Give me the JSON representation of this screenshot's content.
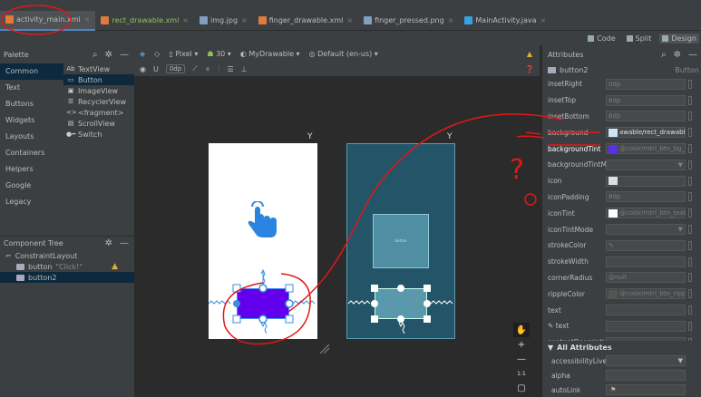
{
  "tabs": [
    {
      "label": "activity_main.xml",
      "color": "#e07b3a",
      "active": true
    },
    {
      "label": "rect_drawable.xml",
      "color": "#e07b3a",
      "green": true
    },
    {
      "label": "img.jpg",
      "color": "#7fa0c0"
    },
    {
      "label": "finger_drawable.xml",
      "color": "#e07b3a"
    },
    {
      "label": "finger_pressed.png",
      "color": "#7fa0c0"
    },
    {
      "label": "MainActivity.java",
      "color": "#3aa0e0"
    }
  ],
  "tab_close": "×",
  "view_modes": {
    "code": "Code",
    "split": "Split",
    "design": "Design"
  },
  "palette": {
    "title": "Palette",
    "categories": [
      "Common",
      "Text",
      "Buttons",
      "Widgets",
      "Layouts",
      "Containers",
      "Helpers",
      "Google",
      "Legacy"
    ],
    "items": [
      {
        "icon": "Ab",
        "label": "TextView"
      },
      {
        "icon": "▭",
        "label": "Button"
      },
      {
        "icon": "▣",
        "label": "ImageView"
      },
      {
        "icon": "☰",
        "label": "RecyclerView"
      },
      {
        "icon": "<>",
        "label": "<fragment>"
      },
      {
        "icon": "▤",
        "label": "ScrollView"
      },
      {
        "icon": "●━",
        "label": "Switch"
      }
    ]
  },
  "component_tree": {
    "title": "Component Tree",
    "root": "ConstraintLayout",
    "children": [
      {
        "label": "button",
        "hint": "\"Click!\"",
        "warn": "▲"
      },
      {
        "label": "button2"
      }
    ]
  },
  "design_toolbar": {
    "device": "Pixel",
    "api": "30",
    "theme": "MyDrawable",
    "locale": "Default (en-us)",
    "margin": "0dp"
  },
  "attributes": {
    "title": "Attributes",
    "component": "button2",
    "component_type": "Button",
    "rows": [
      {
        "name": "insetRight",
        "value": "0dp"
      },
      {
        "name": "insetTop",
        "value": "6dp"
      },
      {
        "name": "insetBottom",
        "value": "6dp"
      },
      {
        "name": "background",
        "value": "awable/rect_drawable",
        "bright": true,
        "swatch": "#cfe3f8"
      },
      {
        "name": "backgroundTint",
        "value": "@color/mtrl_btn_bg_c",
        "swatch": "#5a2ef0",
        "hl": true
      },
      {
        "name": "backgroundTintM...",
        "value": "",
        "dropdown": true
      },
      {
        "name": "icon",
        "value": "",
        "swatch": "#dddddd"
      },
      {
        "name": "iconPadding",
        "value": "8dp"
      },
      {
        "name": "iconTint",
        "value": "@color/mtrl_btn_text",
        "swatch": "#ffffff"
      },
      {
        "name": "iconTintMode",
        "value": "",
        "dropdown": true
      },
      {
        "name": "strokeColor",
        "value": "✎"
      },
      {
        "name": "strokeWidth",
        "value": ""
      },
      {
        "name": "cornerRadius",
        "value": "@null"
      },
      {
        "name": "rippleColor",
        "value": "@color/mtrl_btn_rippl",
        "swatch": "#555555"
      },
      {
        "name": "text",
        "value": ""
      },
      {
        "name": "text",
        "value": "",
        "icon": "✎"
      },
      {
        "name": "contentDescription",
        "value": ""
      },
      {
        "name": "textAppearance",
        "value": "@style/TextAppear",
        "arrow": true
      },
      {
        "name": "alpha",
        "value": ""
      }
    ],
    "all_header": "All Attributes",
    "all_rows": [
      {
        "name": "accessibilityLive...",
        "dropdown": true
      },
      {
        "name": "alpha"
      },
      {
        "name": "autoLink",
        "flag": true
      }
    ]
  },
  "zoom": {
    "plus": "+",
    "ratio": "1:1"
  },
  "annotation": {
    "question": "?",
    "color": "#e01818"
  },
  "blueprint_label": "button"
}
